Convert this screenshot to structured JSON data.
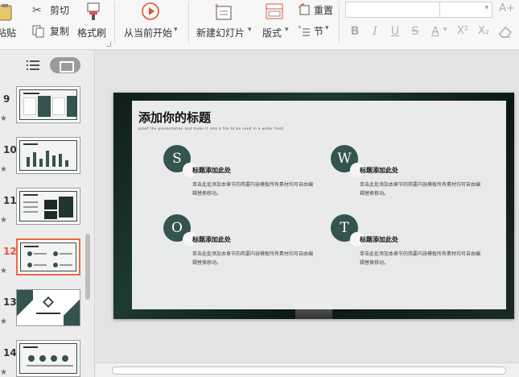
{
  "ribbon": {
    "paste_label": "粘贴",
    "cut_label": "剪切",
    "copy_label": "复制",
    "format_painter_label": "格式刷",
    "play_from_current_label": "从当前开始",
    "new_slide_label": "新建幻灯片",
    "layout_label": "版式",
    "reset_label": "重置",
    "section_label": "节",
    "dropdown_glyph": "▾"
  },
  "formatting": {
    "bold": "B",
    "italic": "I",
    "underline": "U",
    "strike": "S",
    "font_color": "A",
    "superscript": "X²",
    "subscript": "X₂",
    "grow_font": "A+"
  },
  "thumbnails": [
    {
      "number": "9"
    },
    {
      "number": "10"
    },
    {
      "number": "11"
    },
    {
      "number": "12"
    },
    {
      "number": "13"
    },
    {
      "number": "14"
    }
  ],
  "slide": {
    "title": "添加你的标题",
    "subtitle": "proof the presentation and make it into a file to be used in a wider field",
    "items": [
      {
        "letter": "S",
        "heading": "标题添加此处",
        "body": "单击此处添加本章节的简要内容模板所有素材均可自由编辑替换移动。"
      },
      {
        "letter": "W",
        "heading": "标题添加此处",
        "body": "单击此处添加本章节的简要内容模板所有素材均可自由编辑替换移动。"
      },
      {
        "letter": "O",
        "heading": "标题添加此处",
        "body": "单击此处添加本章节的简要内容模板所有素材均可自由编辑替换移动。"
      },
      {
        "letter": "T",
        "heading": "标题添加此处",
        "body": "单击此处添加本章节的简要内容模板所有素材均可自由编辑替换移动。"
      }
    ]
  },
  "colors": {
    "accent": "#35534f",
    "active_thumb": "#f0673f",
    "active_number": "#e2542f"
  }
}
